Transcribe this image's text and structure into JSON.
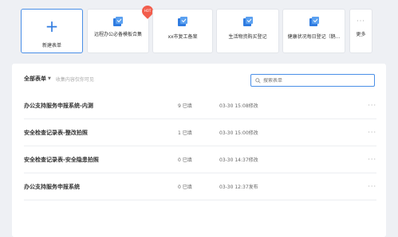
{
  "templates": {
    "new_form": "新建表单",
    "items": [
      {
        "label": "远程办公必备模板合集",
        "hot": "HOT"
      },
      {
        "label": "xx市复工备案"
      },
      {
        "label": "生活物资购买登记"
      },
      {
        "label": "健康状况每日登记（鹅..."
      }
    ],
    "more": "更多"
  },
  "toolbar": {
    "title": "全部表单",
    "hint": "收集内容仅你可见",
    "search_placeholder": "搜索表单"
  },
  "forms": [
    {
      "name": "办公支持服务申报系统-内测",
      "count": "9 已填",
      "time": "03-30 15:08修改"
    },
    {
      "name": "安全检查记录表-整改拍照",
      "count": "1 已填",
      "time": "03-30 15:00修改"
    },
    {
      "name": "安全检查记录表-安全隐患拍照",
      "count": "0 已填",
      "time": "03-30 14:37修改"
    },
    {
      "name": "办公支持服务申报系统",
      "count": "0 已填",
      "time": "03-30 12:37发布"
    }
  ],
  "colors": {
    "accent": "#2f7be0",
    "hot": "#f25d4c"
  }
}
